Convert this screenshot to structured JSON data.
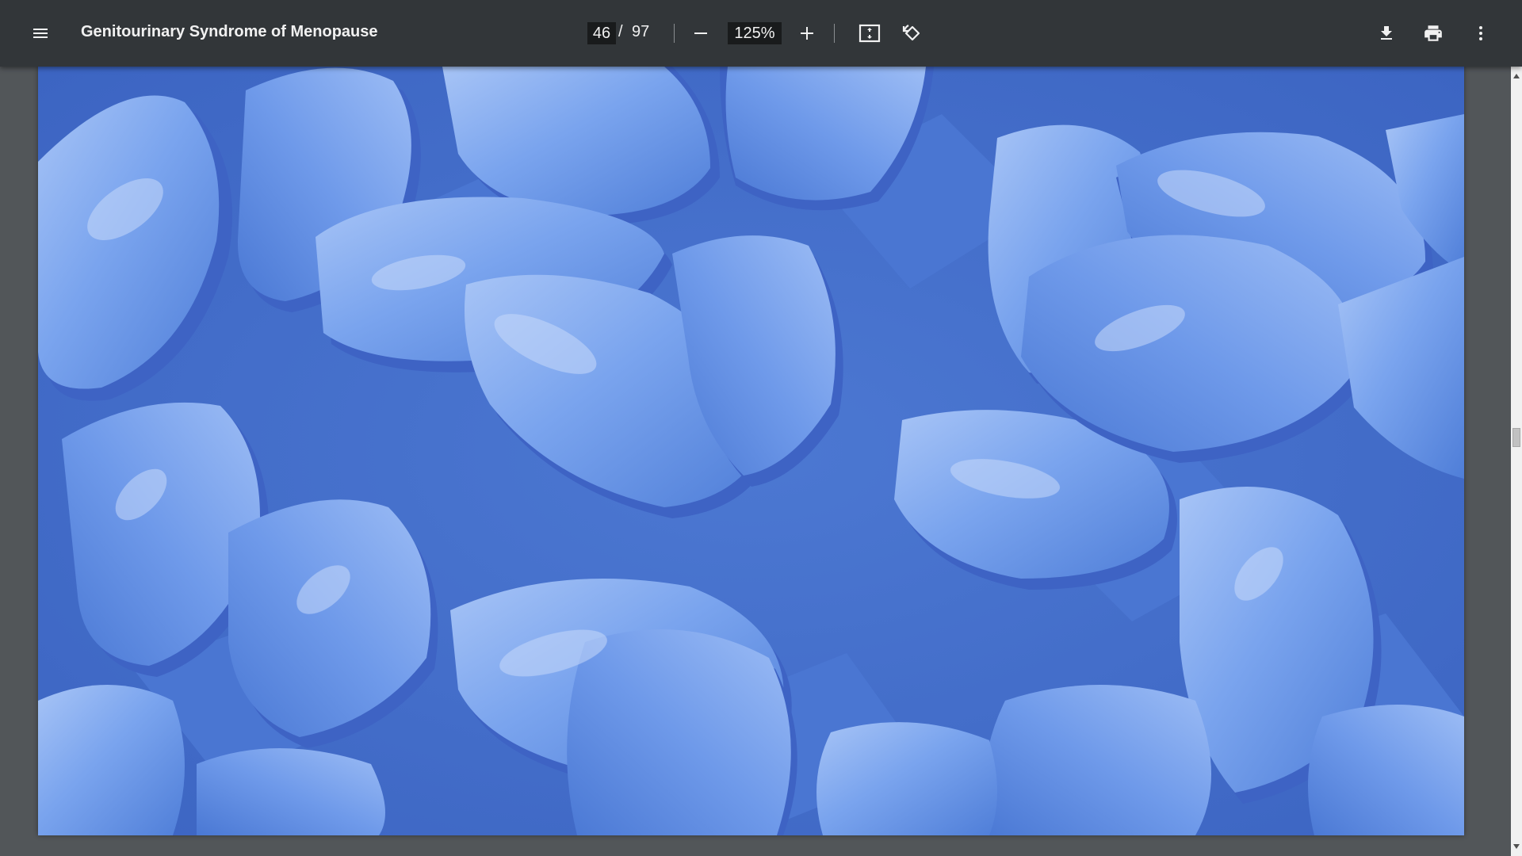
{
  "toolbar": {
    "menu_icon": "hamburger-menu-icon",
    "title": "Genitourinary Syndrome of Menopause",
    "page_current": "46",
    "page_separator": "/",
    "page_total": "97",
    "zoom_out_icon": "minus-icon",
    "zoom_value": "125%",
    "zoom_in_icon": "plus-icon",
    "fit_icon": "fit-to-page-icon",
    "rotate_icon": "rotate-counterclockwise-icon",
    "download_icon": "download-icon",
    "print_icon": "print-icon",
    "more_icon": "more-vertical-icon"
  },
  "document": {
    "page_image": "blue-diamond-pills-photo",
    "scroll_position": 0.43
  },
  "colors": {
    "toolbar_bg": "#323639",
    "viewer_bg": "#525659",
    "pill_blue": "#6b98e8",
    "pill_highlight": "#a7c4f6",
    "pill_shadow": "#3e63c4"
  }
}
